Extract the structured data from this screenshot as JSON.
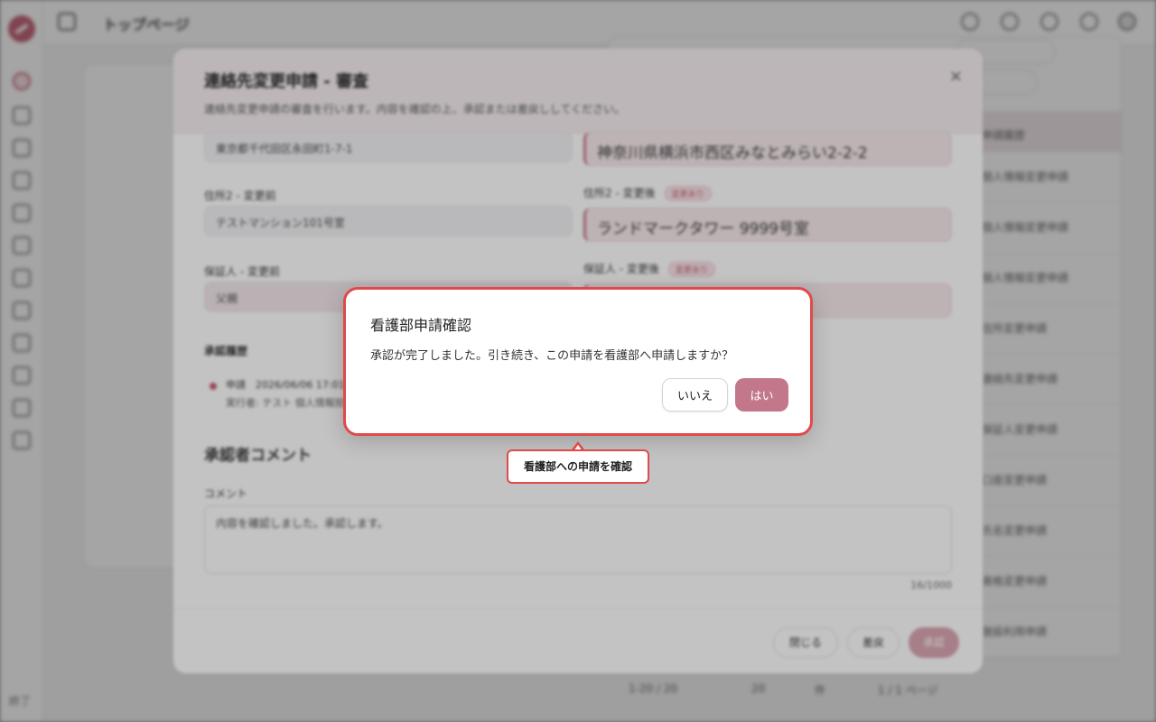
{
  "app": {
    "page_title": "トップページ",
    "sidebar_footer": "終了"
  },
  "background": {
    "list_items": [
      "申請履歴",
      "個人情報変更申請",
      "個人情報変更申請",
      "個人情報変更申請",
      "住所変更申請",
      "連絡先変更申請",
      "保証人変更申請",
      "口座変更申請",
      "氏名変更申請",
      "資格変更申請",
      "施設利用申請"
    ],
    "pager": {
      "range": "1-20 / 20",
      "page_size": "20",
      "unit": "件",
      "page": "1 / 1 ページ"
    }
  },
  "review_modal": {
    "title": "連絡先変更申請 - 審査",
    "description": "連絡先変更申請の審査を行います。内容を確認の上、承認または差戻ししてください。",
    "close_glyph": "×",
    "fields": {
      "address1_before": "東京都千代田区永田町1-7-1",
      "address1_after": "神奈川県横浜市西区みなとみらい2-2-2",
      "address2_label_before": "住所2 - 変更前",
      "address2_before": "テストマンション101号室",
      "address2_label_after": "住所2 - 変更後",
      "address2_after": "ランドマークタワー 9999号室",
      "guarantor_label_before": "保証人 - 変更前",
      "guarantor_before": "父親",
      "guarantor_label_after": "保証人 - 変更後",
      "changed_tag": "変更あり"
    },
    "history": {
      "section_label": "承認履歴",
      "entry_main": "申請　2026/06/06 17:01",
      "entry_sub": "実行者: テスト 個人情報担当"
    },
    "comment": {
      "heading": "承認者コメント",
      "label": "コメント",
      "value": "内容を確認しました。承認します。",
      "counter": "16/1000"
    },
    "footer": {
      "close_label": "閉じる",
      "reject_label": "差戻",
      "approve_label": "承認"
    }
  },
  "confirm_dialog": {
    "title": "看護部申請確認",
    "message": "承認が完了しました。引き続き、この申請を看護部へ申請しますか？",
    "no_label": "いいえ",
    "yes_label": "はい"
  },
  "annotation": {
    "callout": "看護部への申請を確認"
  },
  "colors": {
    "accent": "#c2788a",
    "highlight_border": "#e04a4a"
  }
}
